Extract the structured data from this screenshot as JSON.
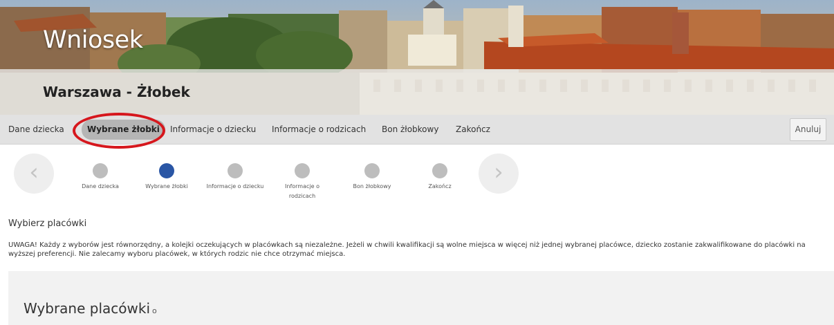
{
  "header": {
    "title": "Wniosek",
    "subtitle": "Warszawa - Żłobek"
  },
  "nav": {
    "items": [
      {
        "label": "Dane dziecka"
      },
      {
        "label": "Wybrane żłobki",
        "active": true
      },
      {
        "label": "Informacje o dziecku"
      },
      {
        "label": "Informacje o rodzicach"
      },
      {
        "label": "Bon żłobkowy"
      },
      {
        "label": "Zakończ"
      }
    ],
    "cancel_label": "Anuluj"
  },
  "stepper": {
    "steps": [
      {
        "label": "Dane dziecka"
      },
      {
        "label": "Wybrane żłobki",
        "current": true
      },
      {
        "label": "Informacje o dziecku"
      },
      {
        "label": "Informacje o rodzicach"
      },
      {
        "label": "Bon żłobkowy"
      },
      {
        "label": "Zakończ"
      }
    ],
    "prev_icon": "chevron-left-icon",
    "next_icon": "chevron-right-icon"
  },
  "content": {
    "section_title": "Wybierz placówki",
    "notice": "UWAGA! Każdy z wyborów jest równorzędny, a kolejki oczekujących w placówkach są niezależne. Jeżeli w chwili kwalifikacji są wolne miejsca w więcej niż jednej wybranej placówce, dziecko zostanie zakwalifikowane do placówki na wyższej preferencji. Nie zalecamy wyboru placówek, w których rodzic nie chce otrzymać miejsca.",
    "panel_title": "Wybrane placówki",
    "panel_icon": "info-icon"
  },
  "colors": {
    "accent": "#2a56a5",
    "highlight": "#d6171d",
    "step_inactive": "#bdbdbd",
    "nav_bg": "#e2e2e2"
  }
}
